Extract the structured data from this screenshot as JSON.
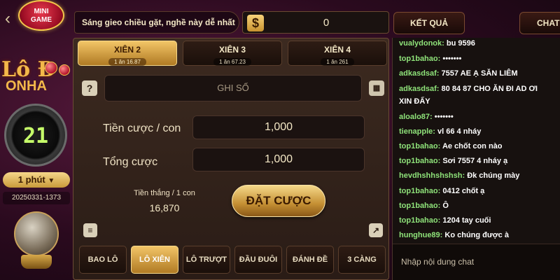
{
  "nav": {
    "back_icon": "back-arrow-icon"
  },
  "mini_game": {
    "line1": "MINI",
    "line2": "GAME"
  },
  "brand": {
    "big": "Lô Đ",
    "small": "ONHA"
  },
  "timer": {
    "value": "21"
  },
  "period": {
    "label": "1 phút",
    "caret": "▼"
  },
  "draw_id": "20250331-1373",
  "hint": "Sáng gieo chiều gặt, nghề này dễ nhất",
  "balance": {
    "currency_symbol": "$",
    "value": "0"
  },
  "result_button": "KẾT QUẢ",
  "chat_button": "CHAT",
  "bet_tabs": [
    {
      "title": "XIÊN 2",
      "sub": "1 ăn 16.87",
      "active": true
    },
    {
      "title": "XIÊN 3",
      "sub": "1 ăn 67.23",
      "active": false
    },
    {
      "title": "XIÊN 4",
      "sub": "1 ăn 261",
      "active": false
    }
  ],
  "help_icon": "?",
  "ghiso_placeholder": "GHI SỐ",
  "stake_label": "Tiền cược / con",
  "stake_value": "1,000",
  "total_label": "Tổng cược",
  "total_value": "1,000",
  "win_label": "Tiền thắng / 1 con",
  "win_value": "16,870",
  "bet_button": "ĐẶT CƯỢC",
  "bottom_tabs": [
    {
      "label": "BAO LÔ",
      "active": false
    },
    {
      "label": "LÔ XIÊN",
      "active": true
    },
    {
      "label": "LÔ TRƯỢT",
      "active": false
    },
    {
      "label": "ĐẦU ĐUÔI",
      "active": false
    },
    {
      "label": "ĐÁNH ĐỀ",
      "active": false
    },
    {
      "label": "3 CÀNG",
      "active": false
    }
  ],
  "chat": {
    "messages": [
      {
        "user": "vualydonok:",
        "text": "bu 9596"
      },
      {
        "user": "top1bahao:",
        "text": "•••••••"
      },
      {
        "user": "adkasdsaf:",
        "text": "7557 AE Ạ SĂN LIÊM"
      },
      {
        "user": "adkasdsaf:",
        "text": "80 84 87 CHO ĂN ĐI AD ƠI"
      },
      {
        "user": "",
        "text": "XIN ĐẤY"
      },
      {
        "user": "aloalo87:",
        "text": "•••••••"
      },
      {
        "user": "tienapple:",
        "text": "vl 66 4 nháy"
      },
      {
        "user": "top1bahao:",
        "text": "Ae chốt con nào"
      },
      {
        "user": "top1bahao:",
        "text": "Sơi 7557 4 nháy ạ"
      },
      {
        "user": "hevdhshhshshsh:",
        "text": "Đk chúng mày"
      },
      {
        "user": "top1bahao:",
        "text": "0412 chốt ạ"
      },
      {
        "user": "top1bahao:",
        "text": "Ô"
      },
      {
        "user": "top1bahao:",
        "text": "1204 tay cuối"
      },
      {
        "user": "hunghue89:",
        "text": "Ko chúng được à"
      }
    ],
    "input_placeholder": "Nhập nội dung chat"
  }
}
